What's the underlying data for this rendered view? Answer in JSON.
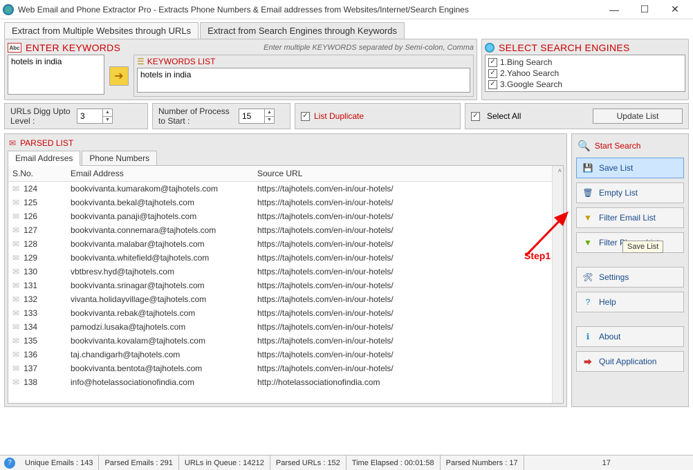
{
  "window": {
    "title": "Web Email and Phone Extractor Pro - Extracts Phone Numbers & Email addresses from Websites/Internet/Search Engines"
  },
  "top_tabs": {
    "urls": "Extract from Multiple Websites through URLs",
    "keywords": "Extract from Search Engines through Keywords"
  },
  "keywords_panel": {
    "title": "ENTER KEYWORDS",
    "subtitle": "Enter multiple KEYWORDS separated by Semi-colon, Comma",
    "input_value": "hotels in india",
    "list_title": "KEYWORDS LIST",
    "list_value": "hotels in india"
  },
  "engines_panel": {
    "title": "SELECT SEARCH ENGINES",
    "items": [
      "1.Bing Search",
      "2.Yahoo Search",
      "3.Google Search"
    ],
    "select_all": "Select All",
    "update_btn": "Update List"
  },
  "options": {
    "digg_label": "URLs Digg Upto Level :",
    "digg_value": "3",
    "process_label": "Number of Process to Start :",
    "process_value": "15",
    "list_dup": "List Duplicate"
  },
  "parsed": {
    "title": "PARSED LIST",
    "tab_email": "Email Addreses",
    "tab_phone": "Phone Numbers",
    "col_sno": "S.No.",
    "col_email": "Email Address",
    "col_url": "Source URL",
    "rows": [
      {
        "n": "124",
        "e": "bookvivanta.kumarakom@tajhotels.com",
        "u": "https://tajhotels.com/en-in/our-hotels/"
      },
      {
        "n": "125",
        "e": "bookvivanta.bekal@tajhotels.com",
        "u": "https://tajhotels.com/en-in/our-hotels/"
      },
      {
        "n": "126",
        "e": "bookvivanta.panaji@tajhotels.com",
        "u": "https://tajhotels.com/en-in/our-hotels/"
      },
      {
        "n": "127",
        "e": "bookvivanta.connemara@tajhotels.com",
        "u": "https://tajhotels.com/en-in/our-hotels/"
      },
      {
        "n": "128",
        "e": "bookvivanta.malabar@tajhotels.com",
        "u": "https://tajhotels.com/en-in/our-hotels/"
      },
      {
        "n": "129",
        "e": "bookvivanta.whitefield@tajhotels.com",
        "u": "https://tajhotels.com/en-in/our-hotels/"
      },
      {
        "n": "130",
        "e": "vbtbresv.hyd@tajhotels.com",
        "u": "https://tajhotels.com/en-in/our-hotels/"
      },
      {
        "n": "131",
        "e": "bookvivanta.srinagar@tajhotels.com",
        "u": "https://tajhotels.com/en-in/our-hotels/"
      },
      {
        "n": "132",
        "e": "vivanta.holidayvillage@tajhotels.com",
        "u": "https://tajhotels.com/en-in/our-hotels/"
      },
      {
        "n": "133",
        "e": "bookvivanta.rebak@tajhotels.com",
        "u": "https://tajhotels.com/en-in/our-hotels/"
      },
      {
        "n": "134",
        "e": "pamodzi.lusaka@tajhotels.com",
        "u": "https://tajhotels.com/en-in/our-hotels/"
      },
      {
        "n": "135",
        "e": "bookvivanta.kovalam@tajhotels.com",
        "u": "https://tajhotels.com/en-in/our-hotels/"
      },
      {
        "n": "136",
        "e": "taj.chandigarh@tajhotels.com",
        "u": "https://tajhotels.com/en-in/our-hotels/"
      },
      {
        "n": "137",
        "e": "bookvivanta.bentota@tajhotels.com",
        "u": "https://tajhotels.com/en-in/our-hotels/"
      },
      {
        "n": "138",
        "e": "info@hotelassociationofindia.com",
        "u": "http://hotelassociationofindia.com"
      }
    ]
  },
  "sidebar": {
    "start": "Start Search",
    "save": "Save List",
    "empty": "Empty List",
    "filter_email": "Filter Email List",
    "filter_phone": "Filter Phone List",
    "settings": "Settings",
    "help": "Help",
    "about": "About",
    "quit": "Quit Application"
  },
  "tooltip": "Save List",
  "annotation": "Step1",
  "status": {
    "unique": "Unique Emails :  143",
    "parsed_emails": "Parsed Emails :   291",
    "queue": "URLs in Queue :  14212",
    "parsed_urls": "Parsed URLs :  152",
    "elapsed": "Time Elapsed :   00:01:58",
    "parsed_numbers": "Parsed Numbers :  17",
    "extra": "17"
  }
}
